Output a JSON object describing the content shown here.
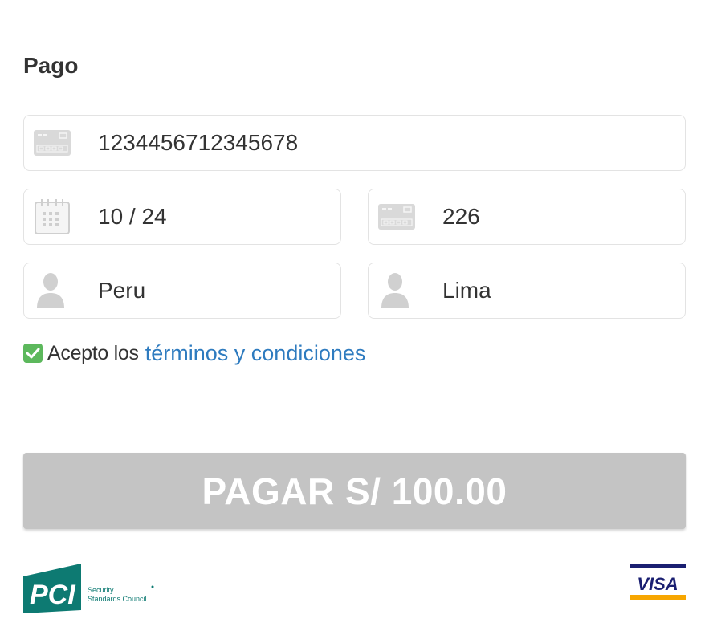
{
  "page": {
    "section_title": "Pago"
  },
  "fields": {
    "card_number": {
      "value": "1234456712345678",
      "icon": "credit-card-icon"
    },
    "expiry": {
      "value": "10 / 24",
      "icon": "calendar-icon"
    },
    "cvv": {
      "value": "226",
      "icon": "credit-card-icon"
    },
    "country": {
      "value": "Peru",
      "icon": "user-icon"
    },
    "city": {
      "value": "Lima",
      "icon": "user-icon"
    }
  },
  "terms": {
    "checked": true,
    "prefix": "Acepto los",
    "link_text": "términos y condiciones"
  },
  "pay_button": {
    "label": "PAGAR S/ 100.00"
  },
  "footer": {
    "pci_logo": {
      "mark": "PCI",
      "line1": "Security",
      "line2": "Standards Council"
    },
    "visa_logo": {
      "text": "VISA"
    }
  },
  "colors": {
    "checkbox": "#5cb85c",
    "link": "#2e7bbf",
    "button_disabled": "#c4c4c4",
    "pci_teal": "#0d7a72",
    "visa_blue": "#1a1f71",
    "visa_gold": "#f7a600"
  }
}
